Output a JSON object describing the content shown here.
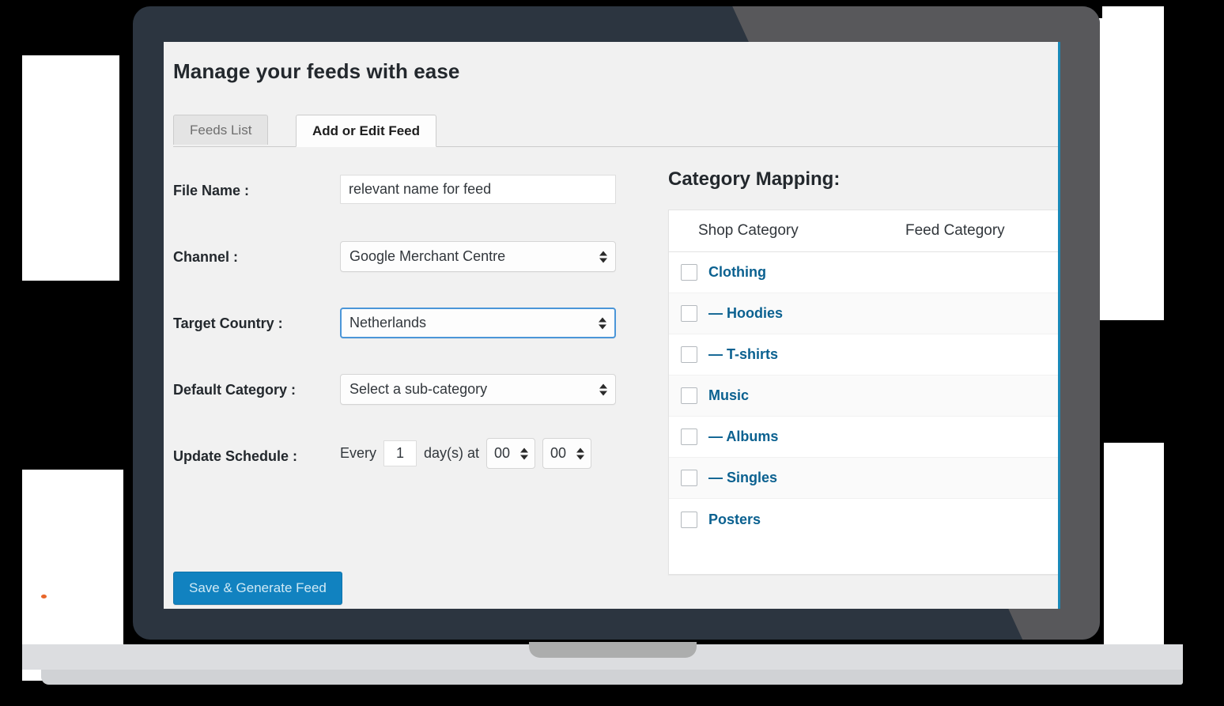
{
  "window": {
    "device": "laptop-mockup"
  },
  "page": {
    "title": "Manage your feeds with ease"
  },
  "tabs": [
    {
      "label": "Feeds List",
      "active": false
    },
    {
      "label": "Add or Edit Feed",
      "active": true
    }
  ],
  "form": {
    "file_name": {
      "label": "File Name :",
      "value": "relevant name for feed",
      "placeholder": "relevant name for feed"
    },
    "channel": {
      "label": "Channel :",
      "value": "Google Merchant Centre"
    },
    "target_country": {
      "label": "Target Country :",
      "value": "Netherlands",
      "focused": true
    },
    "default_category": {
      "label": "Default Category :",
      "value": "Select a sub-category"
    },
    "update_schedule": {
      "label": "Update Schedule :",
      "every_text": "Every",
      "days_value": "1",
      "days_text": "day(s) at",
      "hour_value": "00",
      "minute_value": "00"
    }
  },
  "actions": {
    "save_label": "Save & Generate Feed"
  },
  "category_mapping": {
    "title": "Category Mapping:",
    "columns": {
      "shop": "Shop Category",
      "feed": "Feed Category"
    },
    "rows": [
      {
        "shop": "Clothing",
        "feed": "",
        "checked": false
      },
      {
        "shop": "— Hoodies",
        "feed": "",
        "checked": false
      },
      {
        "shop": "— T-shirts",
        "feed": "",
        "checked": false
      },
      {
        "shop": "Music",
        "feed": "",
        "checked": false
      },
      {
        "shop": "— Albums",
        "feed": "",
        "checked": false
      },
      {
        "shop": "— Singles",
        "feed": "",
        "checked": false
      },
      {
        "shop": "Posters",
        "feed": "",
        "checked": false
      }
    ]
  },
  "colors": {
    "accent_blue": "#1182c0",
    "link_blue": "#0b6190",
    "screen_bg": "#f1f1f1",
    "bezel_dark": "#2c3540",
    "bezel_light": "#58585b",
    "screen_edge": "#1a89b8"
  }
}
